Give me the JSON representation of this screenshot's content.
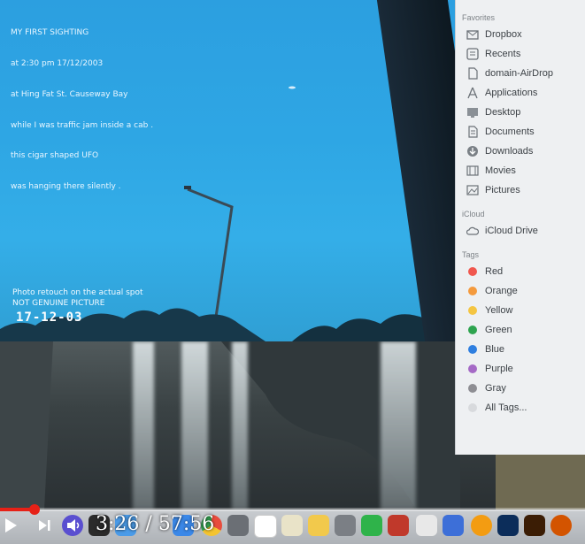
{
  "photo": {
    "caption_lines": [
      "MY FIRST SIGHTING",
      "at 2:30 pm 17/12/2003",
      "at Hing Fat St. Causeway Bay",
      "while I was traffic jam inside a cab .",
      "this cigar shaped UFO",
      "was hanging there silently ."
    ],
    "note_lines": [
      "Photo retouch on the actual spot",
      "NOT GENUINE PICTURE"
    ],
    "date_stamp": "17-12-03"
  },
  "finder": {
    "favorites_header": "Favorites",
    "favorites": [
      {
        "label": "Dropbox",
        "icon": "dropbox-icon"
      },
      {
        "label": "Recents",
        "icon": "recents-icon"
      },
      {
        "label": "domain-AirDrop",
        "icon": "document-icon"
      },
      {
        "label": "Applications",
        "icon": "applications-icon"
      },
      {
        "label": "Desktop",
        "icon": "desktop-icon"
      },
      {
        "label": "Documents",
        "icon": "documents-icon"
      },
      {
        "label": "Downloads",
        "icon": "downloads-icon"
      },
      {
        "label": "Movies",
        "icon": "movies-icon"
      },
      {
        "label": "Pictures",
        "icon": "pictures-icon"
      }
    ],
    "icloud_header": "iCloud",
    "icloud": [
      {
        "label": "iCloud Drive",
        "icon": "cloud-icon"
      }
    ],
    "tags_header": "Tags",
    "tags": [
      {
        "label": "Red",
        "color": "#f0574e"
      },
      {
        "label": "Orange",
        "color": "#f49a3d"
      },
      {
        "label": "Yellow",
        "color": "#f4c542"
      },
      {
        "label": "Green",
        "color": "#2ea44f"
      },
      {
        "label": "Blue",
        "color": "#2f7fe0"
      },
      {
        "label": "Purple",
        "color": "#a56ac6"
      },
      {
        "label": "Gray",
        "color": "#8e8e93"
      },
      {
        "label": "All Tags...",
        "color": "#d8dadd"
      }
    ]
  },
  "player": {
    "current_time": "3:26",
    "separator": "/",
    "duration": "57:56",
    "progress_fraction": 0.059,
    "accent": "#e62117"
  }
}
